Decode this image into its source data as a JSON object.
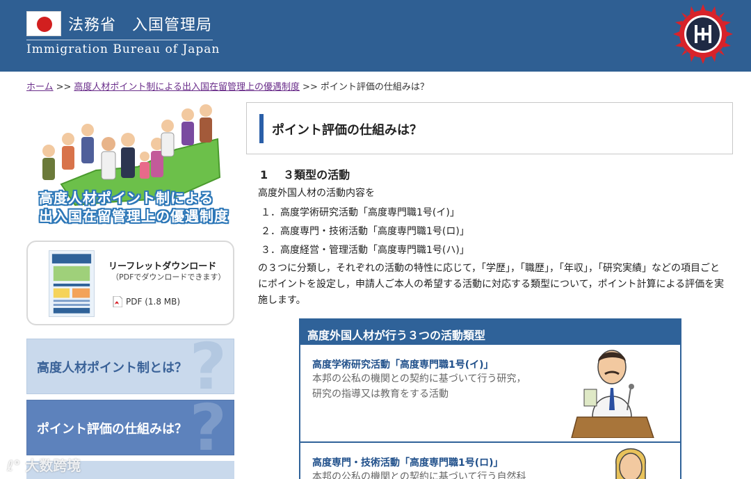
{
  "header": {
    "ministry": "法務省　入国管理局",
    "bureau_en": "Immigration Bureau of Japan"
  },
  "breadcrumb": {
    "home": "ホーム",
    "sep": ">>",
    "parent": "高度人材ポイント制による出入国在留管理上の優遇制度",
    "current": "ポイント評価の仕組みは？"
  },
  "sidebar": {
    "hero_line1": "高度人材ポイント制による",
    "hero_line2": "出入国在留管理上の優遇制度",
    "leaflet_title": "リーフレットダウンロード",
    "leaflet_sub": "（PDFでダウンロードできます）",
    "pdf_link": "PDF (1.8 MB)",
    "nav": [
      {
        "label": "高度人材ポイント制とは？",
        "q": "?"
      },
      {
        "label": "ポイント評価の仕組みは？",
        "q": "?"
      }
    ]
  },
  "main": {
    "page_title": "ポイント評価の仕組みは？",
    "section_num": "1",
    "section_title": "３類型の活動",
    "intro": "高度外国人材の活動内容を",
    "items": [
      "１．高度学術研究活動「高度専門職1号(イ)」",
      "２．高度専門・技術活動「高度専門職1号(ロ)」",
      "３．高度経営・管理活動「高度専門職1号(ハ)」"
    ],
    "body": "の３つに分類し，それぞれの活動の特性に応じて，「学歴」，「職歴」，「年収」，「研究実績」などの項目ごとにポイントを設定し，申請人ご本人の希望する活動に対応する類型について，ポイント計算による評価を実施します。",
    "types_box": {
      "header": "高度外国人材が行う３つの活動類型",
      "types": [
        {
          "title": "高度学術研究活動「高度専門職1号(イ)」",
          "desc1": "本邦の公私の機関との契約に基づいて行う研究，",
          "desc2": "研究の指導又は教育をする活動"
        },
        {
          "title": "高度専門・技術活動「高度専門職1号(ロ)」",
          "desc1": "本邦の公私の機関との契約に基づいて行う自然科"
        }
      ]
    }
  },
  "watermark": "大数跨境",
  "colors": {
    "header_bg": "#2f5f93",
    "accent_blue": "#2f6299",
    "link_purple": "#6a2d8a",
    "nav_active": "#5d82bc",
    "nav_inactive": "#c9d9ec"
  }
}
